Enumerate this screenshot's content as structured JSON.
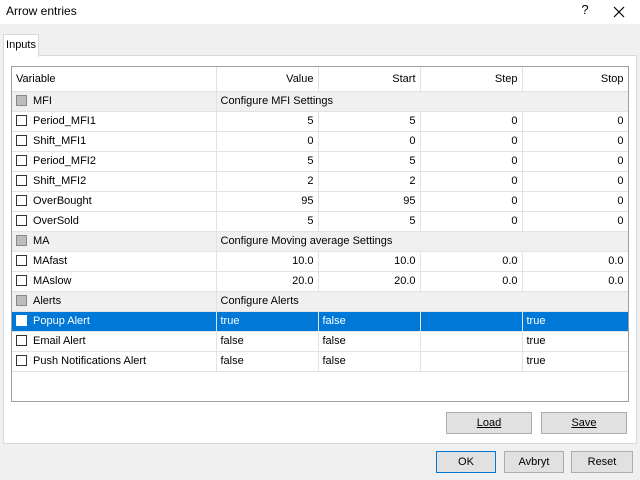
{
  "window": {
    "title": "Arrow entries",
    "help_label": "?",
    "close_icon": "close-icon"
  },
  "tabs": [
    {
      "label": "Inputs"
    }
  ],
  "grid": {
    "columns": [
      "Variable",
      "Value",
      "Start",
      "Step",
      "Stop"
    ],
    "rows": [
      {
        "kind": "group",
        "variable": "MFI",
        "value": "Configure MFI Settings"
      },
      {
        "kind": "param",
        "variable": "Period_MFI1",
        "value": "5",
        "start": "5",
        "step": "0",
        "stop": "0"
      },
      {
        "kind": "param",
        "variable": "Shift_MFI1",
        "value": "0",
        "start": "0",
        "step": "0",
        "stop": "0"
      },
      {
        "kind": "param",
        "variable": "Period_MFI2",
        "value": "5",
        "start": "5",
        "step": "0",
        "stop": "0"
      },
      {
        "kind": "param",
        "variable": "Shift_MFI2",
        "value": "2",
        "start": "2",
        "step": "0",
        "stop": "0"
      },
      {
        "kind": "param",
        "variable": "OverBought",
        "value": "95",
        "start": "95",
        "step": "0",
        "stop": "0"
      },
      {
        "kind": "param",
        "variable": "OverSold",
        "value": "5",
        "start": "5",
        "step": "0",
        "stop": "0"
      },
      {
        "kind": "group",
        "variable": "MA",
        "value": "Configure Moving average Settings"
      },
      {
        "kind": "param",
        "variable": "MAfast",
        "value": "10.0",
        "start": "10.0",
        "step": "0.0",
        "stop": "0.0"
      },
      {
        "kind": "param",
        "variable": "MAslow",
        "value": "20.0",
        "start": "20.0",
        "step": "0.0",
        "stop": "0.0"
      },
      {
        "kind": "group",
        "variable": "Alerts",
        "value": "Configure Alerts"
      },
      {
        "kind": "bool",
        "variable": "Popup Alert",
        "value": "true",
        "start": "false",
        "step": "",
        "stop": "true",
        "selected": true
      },
      {
        "kind": "bool",
        "variable": "Email Alert",
        "value": "false",
        "start": "false",
        "step": "",
        "stop": "true"
      },
      {
        "kind": "bool",
        "variable": "Push Notifications Alert",
        "value": "false",
        "start": "false",
        "step": "",
        "stop": "true"
      }
    ]
  },
  "buttons": {
    "load": "Load",
    "save": "Save",
    "ok": "OK",
    "cancel": "Avbryt",
    "reset": "Reset"
  }
}
